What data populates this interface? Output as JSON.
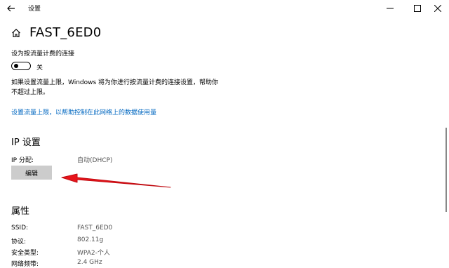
{
  "window": {
    "title": "设置",
    "minimize_glyph": "—",
    "maximize_glyph": "☐",
    "close_glyph": "✕"
  },
  "page": {
    "title": "FAST_6ED0"
  },
  "metered": {
    "label": "设为按流量计费的连接",
    "toggle_state": "关",
    "toggle_on": false,
    "description": "如果设置流量上限，Windows 将为你进行按流量计费的连接设置，帮助你不超过上限。",
    "link": "设置流量上限，以帮助控制在此网络上的数据使用量"
  },
  "ip": {
    "section_title": "IP 设置",
    "assign_label": "IP 分配:",
    "assign_value": "自动(DHCP)",
    "edit_button": "编辑"
  },
  "properties": {
    "section_title": "属性",
    "rows": [
      {
        "label": "SSID:",
        "value": "FAST_6ED0"
      },
      {
        "label": "协议:",
        "value": "802.11g"
      },
      {
        "label": "安全类型:",
        "value": "WPA2-个人"
      },
      {
        "label": "网络频带:",
        "value": "2.4 GHz"
      }
    ]
  },
  "colors": {
    "link": "#0067c0",
    "arrow": "#e8141b",
    "button_bg": "#cccccc"
  },
  "icons": [
    "back-arrow-icon",
    "home-icon",
    "minimize-icon",
    "maximize-icon",
    "close-icon"
  ]
}
